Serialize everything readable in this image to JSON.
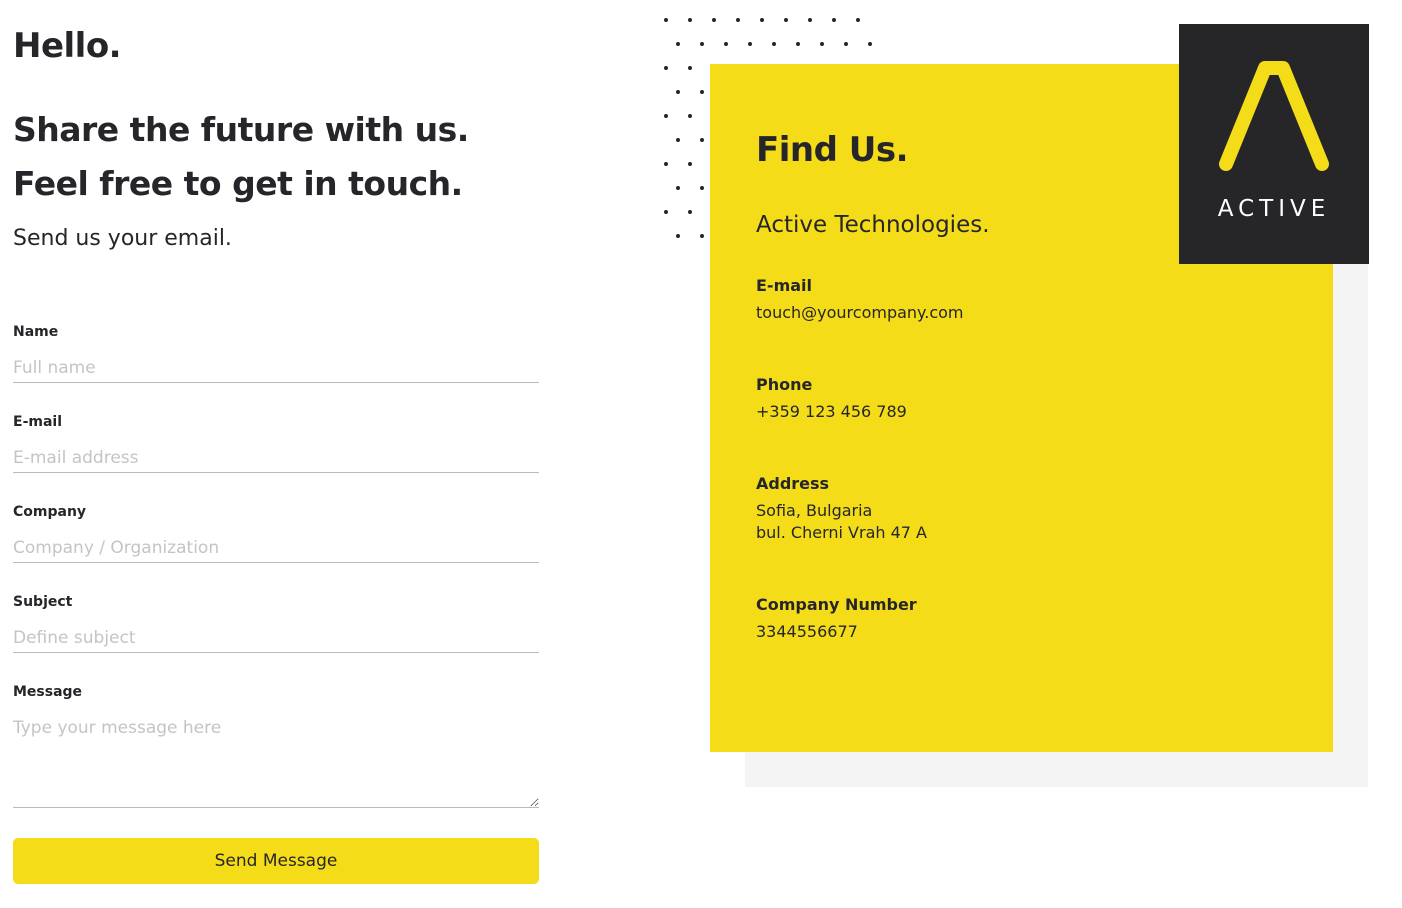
{
  "intro": {
    "greeting": "Hello.",
    "tagline_line1": "Share the future with us.",
    "tagline_line2": "Feel free to get in touch.",
    "subtitle": "Send us your email."
  },
  "form": {
    "name": {
      "label": "Name",
      "placeholder": "Full name"
    },
    "email": {
      "label": "E-mail",
      "placeholder": "E-mail address"
    },
    "company": {
      "label": "Company",
      "placeholder": "Company / Organization"
    },
    "subject": {
      "label": "Subject",
      "placeholder": "Define subject"
    },
    "message": {
      "label": "Message",
      "placeholder": "Type your message here"
    },
    "submit_label": "Send Message"
  },
  "contact": {
    "heading": "Find Us.",
    "company_name": "Active Technologies.",
    "email": {
      "label": "E-mail",
      "value": "touch@yourcompany.com"
    },
    "phone": {
      "label": "Phone",
      "value": "+359 123 456 789"
    },
    "address": {
      "label": "Address",
      "line1": "Sofia, Bulgaria",
      "line2": "bul. Cherni Vrah 47 A"
    },
    "company_number": {
      "label": "Company Number",
      "value": "3344556677"
    }
  },
  "logo": {
    "text": "ACTIVE"
  },
  "colors": {
    "accent": "#f4dc18",
    "dark": "#262628",
    "text": "#26262a",
    "muted_bg": "#f4f4f4"
  }
}
